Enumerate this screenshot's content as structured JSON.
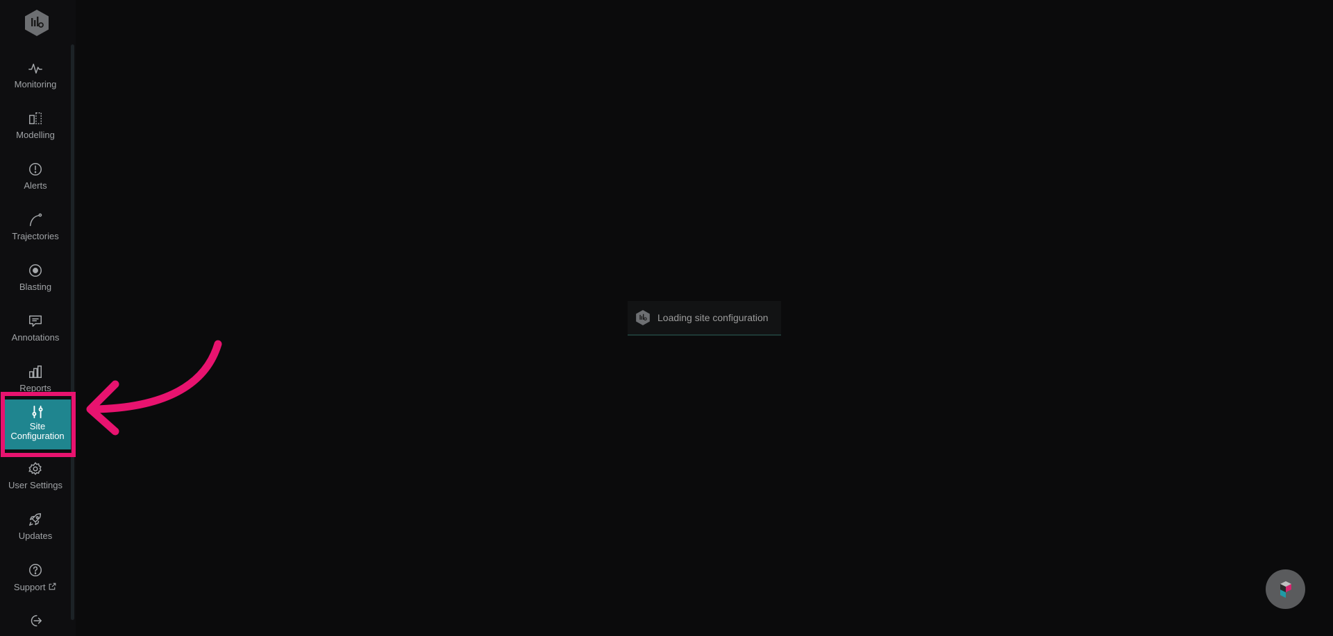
{
  "sidebar": {
    "logo_icon": "hexagon-logo-icon",
    "items": [
      {
        "label": "Monitoring",
        "icon": "pulse-icon"
      },
      {
        "label": "Modelling",
        "icon": "modelling-icon"
      },
      {
        "label": "Alerts",
        "icon": "alert-circle-icon"
      },
      {
        "label": "Trajectories",
        "icon": "trajectory-curve-icon"
      },
      {
        "label": "Blasting",
        "icon": "target-icon"
      },
      {
        "label": "Annotations",
        "icon": "message-icon"
      },
      {
        "label": "Reports",
        "icon": "bar-chart-icon"
      },
      {
        "label_line1": "Site",
        "label_line2": "Configuration",
        "icon": "sliders-icon",
        "active": true
      },
      {
        "label": "User Settings",
        "icon": "gear-icon"
      },
      {
        "label": "Updates",
        "icon": "rocket-icon"
      },
      {
        "label": "Support",
        "icon": "help-circle-icon",
        "suffix_icon": "external-link-icon"
      },
      {
        "label": "",
        "icon": "logout-icon"
      }
    ]
  },
  "main": {
    "loading_text": "Loading site configuration"
  },
  "colors": {
    "accent": "#1f858f",
    "highlight": "#e8136f",
    "background": "#0b0b0c"
  },
  "help_bubble": {
    "icon": "chat-help-icon"
  }
}
